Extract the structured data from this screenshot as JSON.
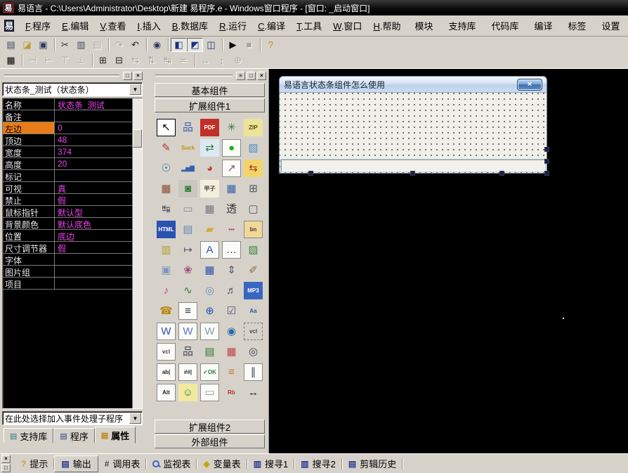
{
  "ui": {
    "arrow_down": "▼",
    "min_buttons": [
      "□",
      "×"
    ],
    "palette_buttons": [
      "≡",
      "□",
      "×"
    ],
    "bottom_corner_buttons": [
      "×",
      "□"
    ]
  },
  "window": {
    "title": "易语言 - C:\\Users\\Administrator\\Desktop\\新建 易程序.e - Windows窗口程序 - [窗口: _启动窗口]",
    "logo_glyph": "易"
  },
  "menu": {
    "items": [
      {
        "key": "F",
        "label": "程序"
      },
      {
        "key": "E",
        "label": "编辑"
      },
      {
        "key": "V",
        "label": "查看"
      },
      {
        "key": "I",
        "label": "插入"
      },
      {
        "key": "B",
        "label": "数据库"
      },
      {
        "key": "R",
        "label": "运行"
      },
      {
        "key": "C",
        "label": "编译"
      },
      {
        "key": "T",
        "label": "工具"
      },
      {
        "key": "W",
        "label": "窗口"
      },
      {
        "key": "H",
        "label": "帮助"
      }
    ],
    "right_items": [
      "模块",
      "支持库",
      "代码库",
      "编译",
      "标签",
      "设置"
    ]
  },
  "toolbar1": [
    {
      "n": "new-doc-icon",
      "g": "▤",
      "c": "#3a4a66"
    },
    {
      "n": "open-icon",
      "g": "◪",
      "c": "#c09a2c"
    },
    {
      "n": "save-icon",
      "g": "▣",
      "c": "#2c3a60"
    },
    {
      "sep": true
    },
    {
      "n": "cut-icon",
      "g": "✂",
      "c": "#333333"
    },
    {
      "n": "copy-icon",
      "g": "▥",
      "c": "#3a4a66"
    },
    {
      "n": "paste-icon",
      "g": "▤",
      "dis": true
    },
    {
      "sep": true
    },
    {
      "n": "redo-icon",
      "g": "↷",
      "dis": true
    },
    {
      "n": "undo-icon",
      "g": "↶",
      "c": "#222222"
    },
    {
      "sep": true
    },
    {
      "n": "view-code-icon",
      "g": "◉",
      "c": "#2c3a60"
    },
    {
      "sep": true
    },
    {
      "n": "layout-left-icon",
      "g": "◧",
      "c": "#14327e",
      "press": true
    },
    {
      "n": "layout-top-icon",
      "g": "◩",
      "c": "#14327e",
      "press": true
    },
    {
      "n": "layout-grid-icon",
      "g": "◫",
      "c": "#14327e"
    },
    {
      "sep": true
    },
    {
      "n": "run-icon",
      "g": "▶",
      "c": "#000000"
    },
    {
      "n": "stop-icon",
      "g": "■",
      "dis": true
    },
    {
      "sep": true
    },
    {
      "n": "find-help-icon",
      "g": "?",
      "c": "#c09000"
    }
  ],
  "toolbar2": [
    {
      "n": "form-designer-icon",
      "g": "▦",
      "c": "#000000"
    },
    {
      "sep": true
    },
    {
      "n": "align-left-icon",
      "g": "⊣",
      "dis": true
    },
    {
      "n": "align-right-icon",
      "g": "⊢",
      "dis": true
    },
    {
      "n": "align-top-icon",
      "g": "⊤",
      "dis": true
    },
    {
      "n": "align-bottom-icon",
      "g": "⊥",
      "dis": true
    },
    {
      "sep": true
    },
    {
      "n": "center-horizontal-icon",
      "g": "⊞",
      "c": "#222222"
    },
    {
      "n": "center-vertical-icon",
      "g": "⊟",
      "c": "#222222"
    },
    {
      "n": "space-across-icon",
      "g": "⇆",
      "dis": true
    },
    {
      "n": "space-down-icon",
      "g": "⇅",
      "dis": true
    },
    {
      "n": "same-width-icon",
      "g": "↹",
      "dis": true
    },
    {
      "n": "same-height-icon",
      "g": "≍",
      "dis": true
    },
    {
      "sep": true
    },
    {
      "n": "fit-width-icon",
      "g": "↔",
      "dis": true
    },
    {
      "n": "fit-height-icon",
      "g": "↕",
      "dis": true
    },
    {
      "n": "fit-both-icon",
      "g": "⊕",
      "dis": true
    }
  ],
  "left_panel": {
    "selector_value": "状态条_测试（状态条）",
    "properties": [
      {
        "label": "名称",
        "value": "状态条_测试"
      },
      {
        "label": "备注",
        "value": ""
      },
      {
        "label": "左边",
        "value": "0",
        "selected": true
      },
      {
        "label": "顶边",
        "value": "48"
      },
      {
        "label": "宽度",
        "value": "374"
      },
      {
        "label": "高度",
        "value": "20"
      },
      {
        "label": "标记",
        "value": ""
      },
      {
        "label": "可视",
        "value": "真"
      },
      {
        "label": "禁止",
        "value": "假"
      },
      {
        "label": "鼠标指针",
        "value": "默认型"
      },
      {
        "label": "背景颜色",
        "value": "默认底色"
      },
      {
        "label": "位置",
        "value": "底边"
      },
      {
        "label": "尺寸调节器",
        "value": "假"
      },
      {
        "label": "字体",
        "value": ""
      },
      {
        "label": "图片组",
        "value": ""
      },
      {
        "label": "项目",
        "value": ""
      }
    ],
    "event_selector_value": "在此处选择加入事件处理子程序",
    "tabs": [
      {
        "label": "支持库",
        "icon": "support-libs-icon",
        "glyph": "▤",
        "color": "#2e7d8a"
      },
      {
        "label": "程序",
        "icon": "program-icon",
        "glyph": "▤",
        "color": "#2c3a90"
      },
      {
        "label": "属性",
        "icon": "properties-icon",
        "glyph": "▤",
        "color": "#b8860b",
        "active": true
      }
    ]
  },
  "palette": {
    "top_buttons": [
      "基本组件",
      "扩展组件1"
    ],
    "bottom_buttons": [
      "扩展组件2",
      "外部组件"
    ],
    "icons": [
      {
        "n": "cursor-icon",
        "g": "↖",
        "c": "#000000",
        "sel": true
      },
      {
        "n": "flowchart-icon",
        "g": "品",
        "c": "#3a5fae"
      },
      {
        "n": "pdf-icon",
        "g": "PDF",
        "c": "#ffffff",
        "b": "#c03028",
        "sm": true
      },
      {
        "n": "turtle-icon",
        "g": "✳",
        "c": "#2e7d32"
      },
      {
        "n": "zip-icon",
        "g": "ZIP",
        "c": "#554400",
        "b": "#ede39a",
        "sm": true
      },
      {
        "n": "script-icon",
        "g": "✎",
        "c": "#b03030"
      },
      {
        "n": "socket-icon",
        "g": "Sock",
        "c": "#c79114",
        "sm": true
      },
      {
        "n": "window-swap-icon",
        "g": "⇄",
        "c": "#2e7d32",
        "b": "#dce9f5"
      },
      {
        "n": "green-ball-icon",
        "g": "●",
        "c": "#1faa1f",
        "bd": true
      },
      {
        "n": "image-swap-icon",
        "g": "▧",
        "c": "#4a90c2"
      },
      {
        "n": "webcam-icon",
        "g": "☉",
        "c": "#2a7a8a"
      },
      {
        "n": "bar-chart-icon",
        "g": "▂▅▇",
        "c": "#3a5fae",
        "sm": true
      },
      {
        "n": "pie-chart-icon",
        "g": "◕",
        "c": "#c23b33"
      },
      {
        "n": "line-chart-icon",
        "g": "↗",
        "c": "#8a4a8a",
        "bd": true
      },
      {
        "n": "db-sync-icon",
        "g": "⇆",
        "c": "#a03020",
        "b": "#f2d46a"
      },
      {
        "n": "table-sync-icon",
        "g": "▦",
        "c": "#8a4a30"
      },
      {
        "n": "frame-component-icon",
        "g": "◙",
        "c": "#2e7d32",
        "b": "#cac7c0"
      },
      {
        "n": "jiazi-icon",
        "g": "甲子",
        "c": "#444444",
        "b": "#f4efdc",
        "sm": true
      },
      {
        "n": "calendar-icon",
        "g": "▦",
        "c": "#3a5fae"
      },
      {
        "n": "tree-view-icon",
        "g": "⊞",
        "c": "#555566"
      },
      {
        "n": "h-slider-icon",
        "g": "↹",
        "c": "#555566"
      },
      {
        "n": "pages-icon",
        "g": "▭",
        "c": "#888899"
      },
      {
        "n": "grid-calendar-icon",
        "g": "▦",
        "c": "#777788"
      },
      {
        "n": "transparent-label-icon",
        "g": "透",
        "c": "#333333"
      },
      {
        "n": "tooltip-icon",
        "g": "▢",
        "c": "#555566"
      },
      {
        "n": "html-view-icon",
        "g": "HTML",
        "c": "#ffffff",
        "b": "#2a52b0",
        "sm": true
      },
      {
        "n": "panel-icon",
        "g": "▤",
        "c": "#6a84b4"
      },
      {
        "n": "folder-icon",
        "g": "▰",
        "c": "#d2a93c"
      },
      {
        "n": "color-bar-icon",
        "g": "▪▪▪",
        "c": "#b03030",
        "sm": true
      },
      {
        "n": "bn-button-icon",
        "g": "bn",
        "c": "#553333",
        "b": "#f0d89a",
        "sm": true,
        "bd": true
      },
      {
        "n": "film-icon",
        "g": "▥",
        "c": "#b59a2a"
      },
      {
        "n": "ruler-icon",
        "g": "↦",
        "c": "#555566"
      },
      {
        "n": "rich-doc-icon",
        "g": "A",
        "c": "#2a52b0",
        "bd": true
      },
      {
        "n": "ellipsis-edit-icon",
        "g": "…",
        "c": "#333333",
        "bd": true
      },
      {
        "n": "picture-box-icon",
        "g": "▨",
        "c": "#3a8a3a"
      },
      {
        "n": "layers-icon",
        "g": "▣",
        "c": "#7a96c0"
      },
      {
        "n": "plugin-flower-icon",
        "g": "❀",
        "c": "#a04a7a"
      },
      {
        "n": "grid-e-icon",
        "g": "▦",
        "c": "#2a52b0"
      },
      {
        "n": "volume-mixer-icon",
        "g": "⇕",
        "c": "#555566"
      },
      {
        "n": "wand-icon",
        "g": "✐",
        "c": "#8a6a3a"
      },
      {
        "n": "midi-icon",
        "g": "♪",
        "c": "#c23b88"
      },
      {
        "n": "wave-audio-icon",
        "g": "∿",
        "c": "#2e7d32"
      },
      {
        "n": "cd-player-icon",
        "g": "◎",
        "c": "#6a8ec8"
      },
      {
        "n": "film-audio-icon",
        "g": "♬",
        "c": "#555566"
      },
      {
        "n": "mp3-icon",
        "g": "MP3",
        "c": "#ffffff",
        "b": "#3a66c0",
        "sm": true
      },
      {
        "n": "dial-phone-icon",
        "g": "☎",
        "c": "#b8860b"
      },
      {
        "n": "list-box-icon",
        "g": "≡",
        "c": "#333344",
        "bd": true
      },
      {
        "n": "net-doc-icon",
        "g": "⊕",
        "c": "#2a52b0"
      },
      {
        "n": "check-list-icon",
        "g": "☑",
        "c": "#555566"
      },
      {
        "n": "font-blocks-icon",
        "g": "Aa",
        "c": "#2a52b0",
        "sm": true
      },
      {
        "n": "word-new-icon",
        "g": "W",
        "c": "#2a52b0",
        "bd": true
      },
      {
        "n": "word-doc-icon",
        "g": "W",
        "c": "#5577cc",
        "bd": true
      },
      {
        "n": "word-image-icon",
        "g": "W",
        "c": "#8a96b4",
        "bd": true
      },
      {
        "n": "globe-icon",
        "g": "◉",
        "c": "#2a6ab0"
      },
      {
        "n": "vcl-ghost-icon",
        "g": "vcl",
        "c": "#444455",
        "sm": true,
        "dash": true
      },
      {
        "n": "vcl-box-icon",
        "g": "vcl",
        "c": "#444455",
        "sm": true,
        "bd": true
      },
      {
        "n": "org-chart-icon",
        "g": "品",
        "c": "#444455"
      },
      {
        "n": "tree-panel-icon",
        "g": "▤",
        "c": "#2e7d32"
      },
      {
        "n": "color-grid-icon",
        "g": "▦",
        "c": "#c24444"
      },
      {
        "n": "find-text-icon",
        "g": "◎",
        "c": "#444455"
      },
      {
        "n": "label-edit-icon",
        "g": "ab|",
        "c": "#222233",
        "sm": true,
        "bd": true
      },
      {
        "n": "num-edit-icon",
        "g": "##|",
        "c": "#222233",
        "sm": true,
        "bd": true
      },
      {
        "n": "ok-button-icon",
        "g": "✓OK",
        "c": "#2e7d32",
        "sm": true,
        "bd": true
      },
      {
        "n": "bullet-list-icon",
        "g": "≡",
        "c": "#c87828"
      },
      {
        "n": "text-columns-icon",
        "g": "∥",
        "c": "#444455",
        "bd": true
      },
      {
        "n": "alt-edit-icon",
        "g": "Alt",
        "c": "#222233",
        "sm": true,
        "bd": true
      },
      {
        "n": "folder-msg-icon",
        "g": "☺",
        "c": "#3a7a3a",
        "b": "#f2e9a0"
      },
      {
        "n": "blank-panel-icon",
        "g": "▭",
        "c": "#9999aa",
        "bd": true
      },
      {
        "n": "rb-slider-icon",
        "g": "Rb",
        "c": "#b03030",
        "sm": true
      },
      {
        "n": "h-resize-icon",
        "g": "↔",
        "c": "#222233"
      }
    ]
  },
  "designer": {
    "form_title": "易语言状态条组件怎么使用",
    "close_glyph": "×"
  },
  "bottom_bar": {
    "tabs": [
      {
        "label": "提示",
        "icon": "hint-icon",
        "glyph": "?",
        "color": "#caa21a"
      },
      {
        "label": "输出",
        "icon": "output-icon",
        "glyph": "▤",
        "color": "#2c3a90",
        "active": true
      },
      {
        "label": "调用表",
        "icon": "call-table-icon",
        "glyph": "#",
        "color": "#3a4a66"
      },
      {
        "label": "监视表",
        "icon": "watch-table-icon",
        "glyph": "",
        "color": "#3a66c0",
        "mag": true
      },
      {
        "label": "变量表",
        "icon": "variable-table-icon",
        "glyph": "◈",
        "color": "#c8a000"
      },
      {
        "label": "搜寻1",
        "icon": "search1-icon",
        "glyph": "▥",
        "color": "#2c3a90"
      },
      {
        "label": "搜寻2",
        "icon": "search2-icon",
        "glyph": "▥",
        "color": "#2c3a90"
      },
      {
        "label": "剪辑历史",
        "icon": "clip-history-icon",
        "glyph": "▤",
        "color": "#2c3a90"
      }
    ]
  }
}
